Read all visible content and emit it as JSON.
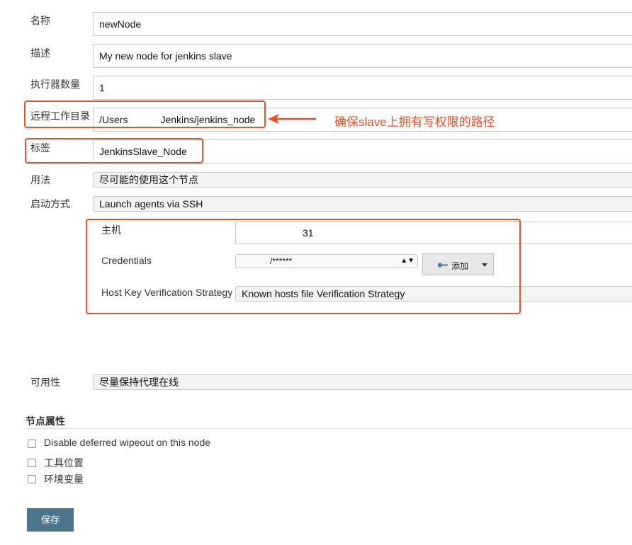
{
  "form": {
    "name": {
      "label": "名称",
      "value": "newNode"
    },
    "description": {
      "label": "描述",
      "value": "My new node for jenkins slave"
    },
    "executors": {
      "label": "执行器数量",
      "value": "1"
    },
    "remote_dir": {
      "label": "远程工作目录",
      "value_prefix": "/Users",
      "value_suffix": "Jenkins/jenkins_node"
    },
    "tags": {
      "label": "标签",
      "value": "JenkinsSlave_Node"
    },
    "usage": {
      "label": "用法",
      "value": "尽可能的使用这个节点"
    },
    "launch": {
      "label": "启动方式",
      "value": "Launch agents via SSH"
    },
    "host": {
      "label": "主机",
      "value_suffix": "31"
    },
    "credentials": {
      "label": "Credentials",
      "value": "/******",
      "add_label": "添加"
    },
    "host_key": {
      "label": "Host Key Verification Strategy",
      "value": "Known hosts file Verification Strategy"
    },
    "availability": {
      "label": "可用性",
      "value": "尽量保持代理在线"
    }
  },
  "node_props": {
    "heading": "节点属性",
    "options": [
      {
        "label": "Disable deferred wipeout on this node",
        "checked": false
      },
      {
        "label": "工具位置",
        "checked": false
      },
      {
        "label": "环境变量",
        "checked": false
      }
    ]
  },
  "annotation": "确保slave上拥有写权限的路径",
  "save_label": "保存",
  "colors": {
    "annotation": "#e4512b",
    "save_button": "#4b758b"
  }
}
